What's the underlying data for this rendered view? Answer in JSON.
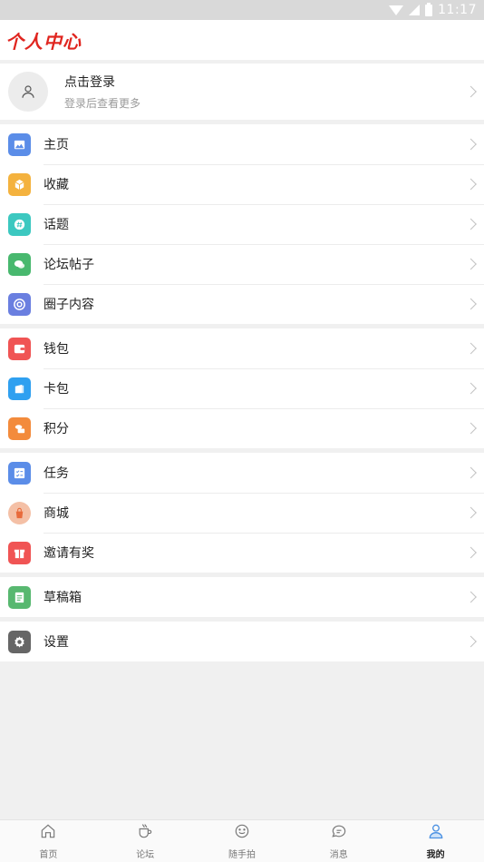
{
  "status_bar": {
    "time": "11:17"
  },
  "header": {
    "title": "个人中心"
  },
  "login": {
    "title": "点击登录",
    "subtitle": "登录后查看更多"
  },
  "groups": [
    {
      "items": [
        {
          "label": "主页",
          "icon": "home-image-icon",
          "color": "#5b8de8"
        },
        {
          "label": "收藏",
          "icon": "box-icon",
          "color": "#f4b23e"
        },
        {
          "label": "话题",
          "icon": "hashtag-icon",
          "color": "#3cc8c0"
        },
        {
          "label": "论坛帖子",
          "icon": "chat-bubbles-icon",
          "color": "#48b86e"
        },
        {
          "label": "圈子内容",
          "icon": "circle-swirl-icon",
          "color": "#6a7fe0"
        }
      ]
    },
    {
      "items": [
        {
          "label": "钱包",
          "icon": "wallet-icon",
          "color": "#f05454"
        },
        {
          "label": "卡包",
          "icon": "card-icon",
          "color": "#2fa0f0"
        },
        {
          "label": "积分",
          "icon": "coins-icon",
          "color": "#f38b3c"
        }
      ]
    },
    {
      "items": [
        {
          "label": "任务",
          "icon": "task-list-icon",
          "color": "#5b8de8"
        },
        {
          "label": "商城",
          "icon": "shopping-bag-icon",
          "color": "#f4c0a6"
        },
        {
          "label": "邀请有奖",
          "icon": "gift-icon",
          "color": "#f05454"
        }
      ]
    },
    {
      "items": [
        {
          "label": "草稿箱",
          "icon": "draft-icon",
          "color": "#58b870"
        }
      ]
    },
    {
      "items": [
        {
          "label": "设置",
          "icon": "gear-icon",
          "color": "#666666"
        }
      ]
    }
  ],
  "tabbar": [
    {
      "label": "首页",
      "icon": "home-icon",
      "active": false
    },
    {
      "label": "论坛",
      "icon": "coffee-cup-icon",
      "active": false
    },
    {
      "label": "随手拍",
      "icon": "camera-smile-icon",
      "active": false
    },
    {
      "label": "消息",
      "icon": "message-icon",
      "active": false
    },
    {
      "label": "我的",
      "icon": "user-icon",
      "active": true
    }
  ],
  "colors": {
    "accent_red": "#e0251f",
    "tab_active": "#4a90e2"
  }
}
